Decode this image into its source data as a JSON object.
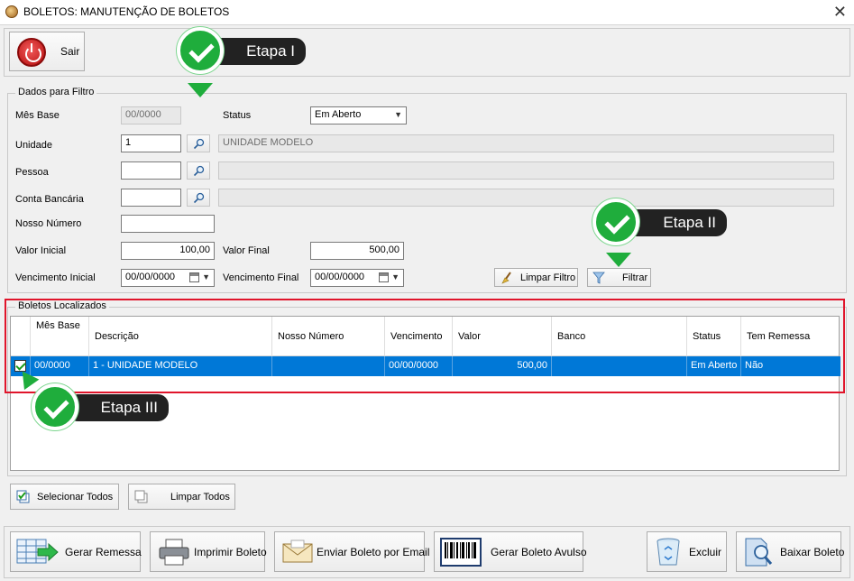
{
  "window": {
    "title": "BOLETOS: MANUTENÇÃO DE BOLETOS",
    "close_glyph": "✕"
  },
  "toolbar": {
    "sair_label": "Sair"
  },
  "filter": {
    "legend": "Dados para Filtro",
    "mes_base_label": "Mês Base",
    "mes_base_value": "00/0000",
    "status_label": "Status",
    "status_value": "Em Aberto",
    "unidade_label": "Unidade",
    "unidade_code": "1",
    "unidade_name": "UNIDADE MODELO",
    "pessoa_label": "Pessoa",
    "pessoa_code": "",
    "pessoa_name": "",
    "conta_label": "Conta Bancária",
    "conta_code": "",
    "conta_name": "",
    "nosso_numero_label": "Nosso Número",
    "nosso_numero_value": "",
    "valor_inicial_label": "Valor Inicial",
    "valor_inicial_value": "100,00",
    "valor_final_label": "Valor Final",
    "valor_final_value": "500,00",
    "venc_inicial_label": "Vencimento Inicial",
    "venc_inicial_value": "00/00/0000",
    "venc_final_label": "Vencimento Final",
    "venc_final_value": "00/00/0000",
    "limpar_filtro_label": "Limpar Filtro",
    "filtrar_label": "Filtrar"
  },
  "results": {
    "legend": "Boletos Localizados",
    "columns": [
      "Mês Base",
      "Descrição",
      "Nosso Número",
      "Vencimento",
      "Valor",
      "Banco",
      "Status",
      "Tem Remessa"
    ],
    "rows": [
      {
        "checked": true,
        "mes_base": "00/0000",
        "descricao": "1 - UNIDADE MODELO",
        "nosso_numero": "",
        "vencimento": "00/00/0000",
        "valor": "500,00",
        "banco": "",
        "status": "Em Aberto",
        "tem_remessa": "Não"
      }
    ]
  },
  "selection": {
    "selecionar_todos_label": "Selecionar Todos",
    "limpar_todos_label": "Limpar Todos"
  },
  "actions": {
    "gerar_remessa": "Gerar Remessa",
    "imprimir_boleto": "Imprimir Boleto",
    "enviar_email": "Enviar Boleto por Email",
    "gerar_avulso": "Gerar Boleto Avulso",
    "excluir": "Excluir",
    "baixar_boleto": "Baixar Boleto"
  },
  "annotations": {
    "etapa1": "Etapa I",
    "etapa2": "Etapa II",
    "etapa3": "Etapa III"
  },
  "colors": {
    "selection": "#0078d7",
    "highlight_frame": "#e0152b",
    "callout_green": "#1fad3c",
    "callout_dark": "#222222"
  }
}
